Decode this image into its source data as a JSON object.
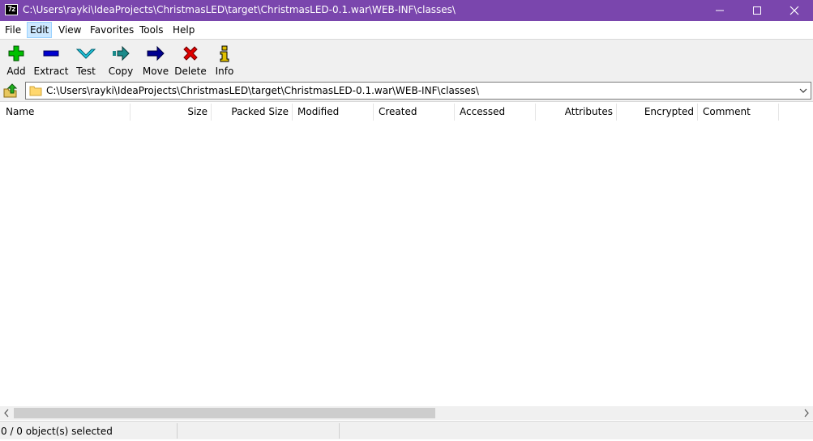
{
  "window": {
    "title": "C:\\Users\\rayki\\IdeaProjects\\ChristmasLED\\target\\ChristmasLED-0.1.war\\WEB-INF\\classes\\",
    "app_icon_text": "7z"
  },
  "menu": {
    "items": [
      {
        "label": "File"
      },
      {
        "label": "Edit",
        "active": true
      },
      {
        "label": "View"
      },
      {
        "label": "Favorites"
      },
      {
        "label": "Tools"
      },
      {
        "label": "Help"
      }
    ]
  },
  "toolbar": {
    "buttons": [
      {
        "label": "Add",
        "icon": "plus-icon",
        "color": "#00c000"
      },
      {
        "label": "Extract",
        "icon": "minus-icon",
        "color": "#0000d0"
      },
      {
        "label": "Test",
        "icon": "check-chevron-icon",
        "color": "#20c8e0"
      },
      {
        "label": "Copy",
        "icon": "copy-arrow-icon",
        "color": "#1a8a8a"
      },
      {
        "label": "Move",
        "icon": "move-arrow-icon",
        "color": "#000090"
      },
      {
        "label": "Delete",
        "icon": "x-icon",
        "color": "#e00000"
      },
      {
        "label": "Info",
        "icon": "info-icon",
        "color": "#e0c000"
      }
    ]
  },
  "address": {
    "path": "C:\\Users\\rayki\\IdeaProjects\\ChristmasLED\\target\\ChristmasLED-0.1.war\\WEB-INF\\classes\\"
  },
  "columns": [
    "Name",
    "Size",
    "Packed Size",
    "Modified",
    "Created",
    "Accessed",
    "Attributes",
    "Encrypted",
    "Comment"
  ],
  "status": {
    "selected": "0 / 0 object(s) selected",
    "cell2": "",
    "cell3": ""
  },
  "colors": {
    "titlebar": "#7a46ad",
    "menu_active": "#cce8ff"
  }
}
